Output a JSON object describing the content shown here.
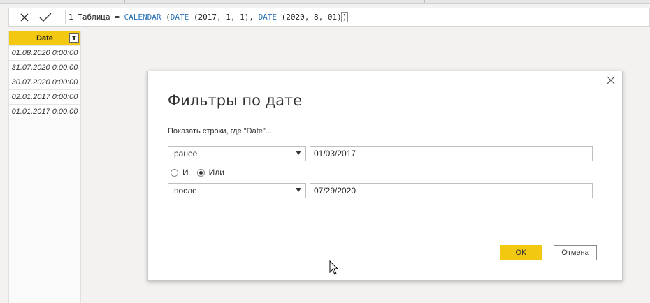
{
  "formula_bar": {
    "line_number": "1",
    "lhs": "Таблица = ",
    "func_calendar": "CALENDAR",
    "paren_open": " (",
    "func_date1": "DATE",
    "args1": " (2017, 1, 1), ",
    "func_date2": "DATE",
    "args2": " (2020, 8, 01)",
    "paren_close": ")"
  },
  "table": {
    "header": "Date",
    "rows": [
      "01.08.2020 0:00:00",
      "31.07.2020 0:00:00",
      "30.07.2020 0:00:00",
      "02.01.2017 0:00:00",
      "01.01.2017 0:00:00"
    ]
  },
  "dialog": {
    "title": "Фильтры по дате",
    "prompt": "Показать строки, где \"Date\"...",
    "condition1": {
      "operator": "ранее",
      "value": "01/03/2017"
    },
    "logic": {
      "and_label": "И",
      "or_label": "Или",
      "selected": "Или"
    },
    "condition2": {
      "operator": "после",
      "value": "07/29/2020"
    },
    "ok_label": "ОК",
    "cancel_label": "Отмена"
  },
  "colors": {
    "accent": "#f2c811",
    "function_blue": "#2b73b8"
  },
  "icons": [
    "cancel-icon",
    "commit-icon",
    "filter-icon",
    "close-icon",
    "dropdown-arrow-icon",
    "mouse-cursor-icon"
  ]
}
